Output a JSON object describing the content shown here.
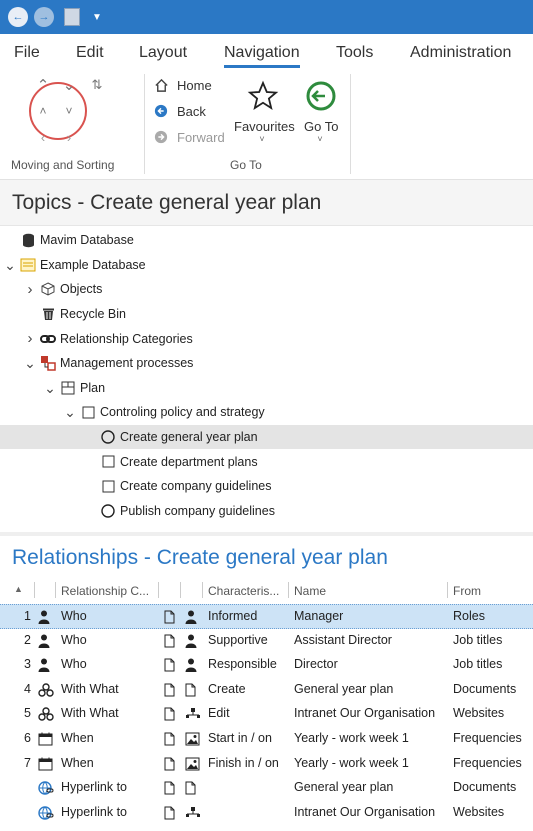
{
  "menu": {
    "items": [
      "File",
      "Edit",
      "Layout",
      "Navigation",
      "Tools",
      "Administration"
    ],
    "active": "Navigation"
  },
  "ribbon": {
    "moving_sorting_label": "Moving and Sorting",
    "goto_label": "Go To",
    "home": "Home",
    "back": "Back",
    "forward": "Forward",
    "favourites": "Favourites",
    "goto": "Go To"
  },
  "topics": {
    "title": "Topics -  Create general year plan",
    "tree": [
      {
        "label": "Mavim Database",
        "icon": "database-icon",
        "depth": 0,
        "chevron": ""
      },
      {
        "label": "Example Database",
        "icon": "folder-icon",
        "depth": 0,
        "chevron": "down"
      },
      {
        "label": "Objects",
        "icon": "cube-icon",
        "depth": 1,
        "chevron": "right"
      },
      {
        "label": "Recycle Bin",
        "icon": "trash-icon",
        "depth": 1,
        "chevron": ""
      },
      {
        "label": "Relationship Categories",
        "icon": "link-icon",
        "depth": 1,
        "chevron": "right"
      },
      {
        "label": "Management processes",
        "icon": "process-icon",
        "depth": 1,
        "chevron": "down"
      },
      {
        "label": "Plan",
        "icon": "grid-icon",
        "depth": 2,
        "chevron": "down"
      },
      {
        "label": "Controling policy and strategy",
        "icon": "square-icon",
        "depth": 3,
        "chevron": "down"
      },
      {
        "label": "Create general year plan",
        "icon": "circle-icon",
        "depth": 4,
        "chevron": "",
        "selected": true
      },
      {
        "label": "Create department plans",
        "icon": "square-icon",
        "depth": 4,
        "chevron": ""
      },
      {
        "label": "Create company guidelines",
        "icon": "square-icon",
        "depth": 4,
        "chevron": ""
      },
      {
        "label": "Publish company guidelines",
        "icon": "circle-icon",
        "depth": 4,
        "chevron": ""
      }
    ]
  },
  "relationships": {
    "title": "Relationships - Create general year plan",
    "headers": {
      "category": "Relationship C...",
      "characteristic": "Characteris...",
      "name": "Name",
      "from": "From"
    },
    "rows": [
      {
        "num": "1",
        "cat_icon": "person-icon",
        "category": "Who",
        "char_icon": "person-icon",
        "characteristic": "Informed",
        "name": "Manager",
        "from": "Roles",
        "selected": true
      },
      {
        "num": "2",
        "cat_icon": "person-icon",
        "category": "Who",
        "char_icon": "person-icon",
        "characteristic": "Supportive",
        "name": "Assistant Director",
        "from": "Job titles"
      },
      {
        "num": "3",
        "cat_icon": "person-icon",
        "category": "Who",
        "char_icon": "person-icon",
        "characteristic": "Responsible",
        "name": "Director",
        "from": "Job titles"
      },
      {
        "num": "4",
        "cat_icon": "cluster-icon",
        "category": "With What",
        "char_icon": "document-icon",
        "characteristic": "Create",
        "name": "General year plan",
        "from": "Documents"
      },
      {
        "num": "5",
        "cat_icon": "cluster-icon",
        "category": "With What",
        "char_icon": "network-icon",
        "characteristic": "Edit",
        "name": "Intranet Our Organisation",
        "from": "Websites"
      },
      {
        "num": "6",
        "cat_icon": "calendar-icon",
        "category": "When",
        "char_icon": "image-icon",
        "characteristic": "Start in / on",
        "name": "Yearly - work week 1",
        "from": "Frequencies"
      },
      {
        "num": "7",
        "cat_icon": "calendar-icon",
        "category": "When",
        "char_icon": "image-icon",
        "characteristic": "Finish in / on",
        "name": "Yearly - work week 1",
        "from": "Frequencies"
      },
      {
        "num": "",
        "cat_icon": "hyperlink-icon",
        "category": "Hyperlink to",
        "char_icon": "document-icon",
        "characteristic": "",
        "name": "General year plan",
        "from": "Documents"
      },
      {
        "num": "",
        "cat_icon": "hyperlink-icon",
        "category": "Hyperlink to",
        "char_icon": "network-icon",
        "characteristic": "",
        "name": "Intranet Our Organisation",
        "from": "Websites"
      }
    ]
  }
}
